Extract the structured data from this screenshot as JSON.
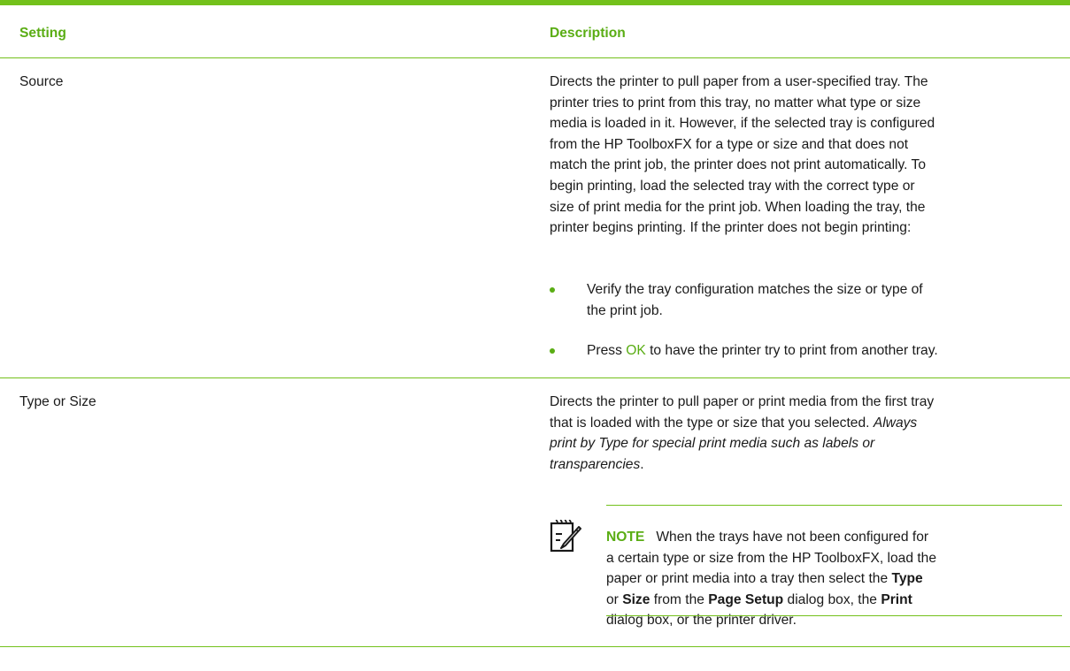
{
  "colors": {
    "accent": "#73c11b",
    "heading": "#5aad14"
  },
  "table": {
    "headers": {
      "setting": "Setting",
      "description": "Description"
    },
    "rows": [
      {
        "setting": "Source",
        "description_lines": [
          "Directs the printer to pull paper from a user-specified tray. The",
          "printer tries to print from this tray, no matter what type or size",
          "media is loaded in it. However, if the selected tray is configured",
          "from the HP ToolboxFX for a type or size and that does not",
          "match the print job, the printer does not print automatically. To",
          "begin printing, load the selected tray with the correct type or",
          "size of print media for the print job. When loading the tray, the",
          "printer begins printing. If the printer does not begin printing:"
        ],
        "bullets": {
          "first_line1": "Verify the tray configuration matches the size or type of",
          "first_line2": "the print job.",
          "second_pre": "Press ",
          "second_key": "OK",
          "second_post": " to have the printer try to print from another tray."
        }
      },
      {
        "setting": "Type or Size",
        "description_lines": [
          "Directs the printer to pull paper or print media from the first tray",
          "that is loaded with the type or size that you selected. "
        ],
        "italic_1": "Always",
        "italic_2": "print by Type for special print media such as labels or",
        "italic_3": "transparencies",
        "trailing_period": ".",
        "note": {
          "label": "NOTE",
          "icon": "note-pencil-icon",
          "line1": "When the trays have not been configured for",
          "line2": "a certain type or size from the HP ToolboxFX, load the",
          "line3_pre": "paper or print media into a tray then select the ",
          "type_word": "Type",
          "or_word": "or ",
          "size_word": "Size",
          "line4_mid": " from the ",
          "page_setup": "Page Setup",
          "line4_post": " dialog box, the ",
          "print_word": "Print",
          "line5": "dialog box, or the printer driver."
        }
      }
    ]
  }
}
